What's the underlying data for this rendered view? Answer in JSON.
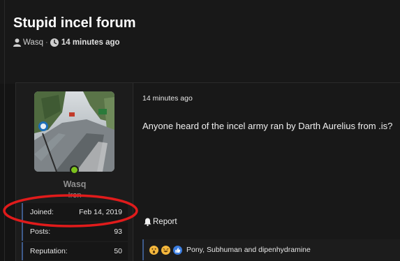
{
  "thread": {
    "title": "Stupid incel forum",
    "author": "Wasq",
    "separator": "·",
    "time": "14 minutes ago"
  },
  "post": {
    "author": {
      "username": "Wasq",
      "title": "Iron",
      "online": true,
      "stats": [
        {
          "label": "Joined:",
          "value": "Feb 14, 2019"
        },
        {
          "label": "Posts:",
          "value": "93"
        },
        {
          "label": "Reputation:",
          "value": "50"
        }
      ]
    },
    "time": "14 minutes ago",
    "body": "Anyone heard of the incel army ran by Darth Aurelius from .is?",
    "report_label": "Report",
    "reactions": {
      "icons": [
        "wow-reaction-icon",
        "laugh-reaction-icon",
        "like-reaction-icon"
      ],
      "names": "Pony, Subhuman and dipenhydramine"
    }
  },
  "colors": {
    "online": "#7cc11c",
    "annotation": "#e01b1b",
    "stat_accent": "#3d5a8a"
  }
}
